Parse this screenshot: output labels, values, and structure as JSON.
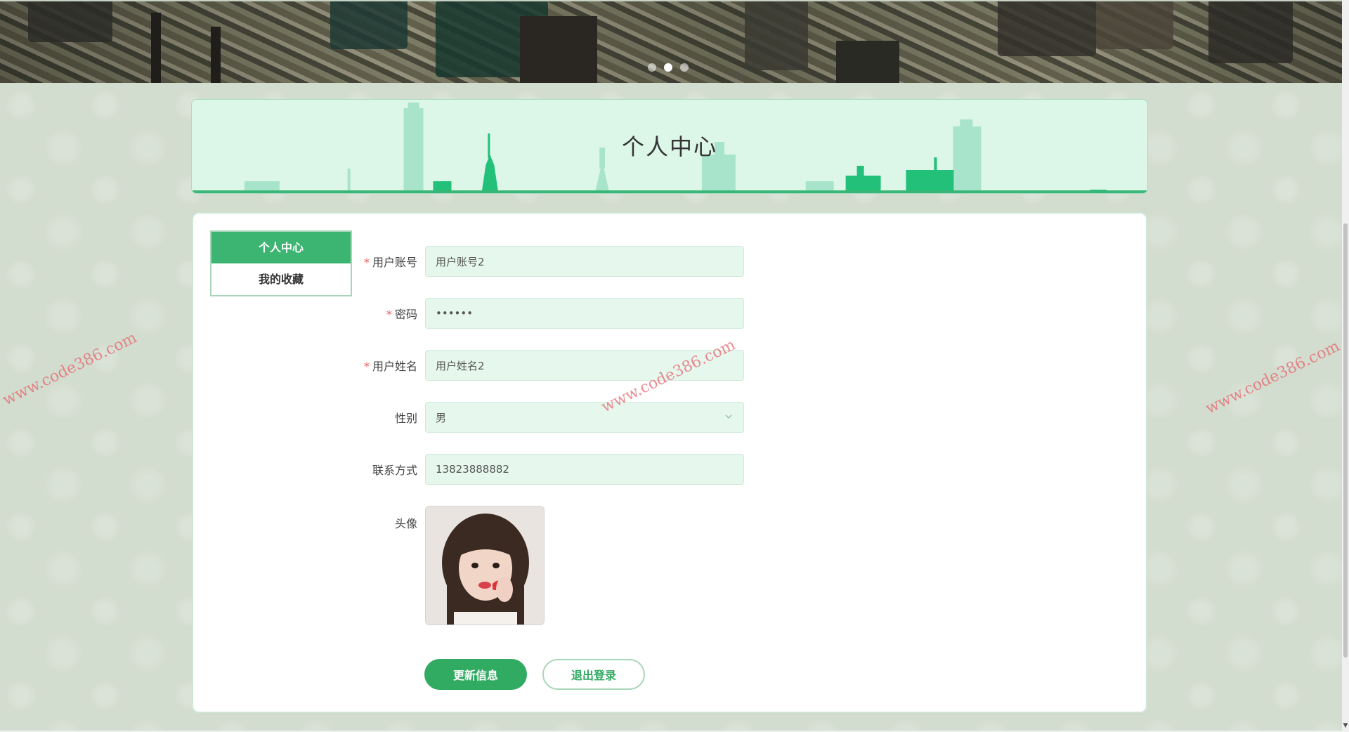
{
  "banner": {
    "slide_count": 3,
    "active_slide": 2
  },
  "header": {
    "title": "个人中心"
  },
  "side_menu": {
    "items": [
      {
        "label": "个人中心",
        "active": true
      },
      {
        "label": "我的收藏",
        "active": false
      }
    ]
  },
  "form": {
    "username": {
      "label": "用户账号",
      "required": true,
      "value": "用户账号2"
    },
    "password": {
      "label": "密码",
      "required": true,
      "value": "••••••"
    },
    "name": {
      "label": "用户姓名",
      "required": true,
      "value": "用户姓名2"
    },
    "gender": {
      "label": "性别",
      "required": false,
      "value": "男"
    },
    "contact": {
      "label": "联系方式",
      "required": false,
      "value": "13823888882"
    },
    "avatar": {
      "label": "头像"
    }
  },
  "buttons": {
    "update": "更新信息",
    "logout": "退出登录"
  },
  "watermarks": [
    "www.code386.com",
    "www.code386.com",
    "www.code386.com"
  ],
  "colors": {
    "accent": "#31aa62",
    "header_bg": "#dcf6e8",
    "input_bg": "#e6f8ee",
    "required": "#f06060"
  }
}
